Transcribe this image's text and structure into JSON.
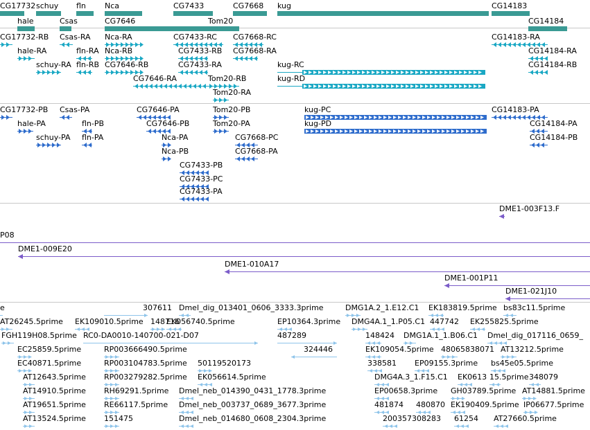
{
  "colors": {
    "gene": "#3a9a94",
    "transcript": "#1aa8c4",
    "protein": "#2e6ccc",
    "clone": "#7b5cc9",
    "est": "#8ec4ea",
    "separator": "#c8c8c8"
  },
  "tracks": {
    "genes": {
      "features": [
        {
          "label": "CG17732"
        },
        {
          "label": "hale"
        },
        {
          "label": "schuy"
        },
        {
          "label": "Csas"
        },
        {
          "label": "fln"
        },
        {
          "label": "Nca"
        },
        {
          "label": "CG7646"
        },
        {
          "label": "CG7433"
        },
        {
          "label": "Tom20"
        },
        {
          "label": "CG7668"
        },
        {
          "label": "kug"
        },
        {
          "label": "CG14183"
        },
        {
          "label": "CG14184"
        }
      ]
    },
    "transcripts": {
      "features": [
        {
          "label": "CG17732-RB"
        },
        {
          "label": "Csas-RA"
        },
        {
          "label": "Nca-RA"
        },
        {
          "label": "CG7433-RC"
        },
        {
          "label": "CG7668-RC"
        },
        {
          "label": "CG14183-RA"
        },
        {
          "label": "hale-RA"
        },
        {
          "label": "fln-RA"
        },
        {
          "label": "Nca-RB"
        },
        {
          "label": "CG7433-RB"
        },
        {
          "label": "CG7668-RA"
        },
        {
          "label": "CG14184-RA"
        },
        {
          "label": "schuy-RA"
        },
        {
          "label": "fln-RB"
        },
        {
          "label": "CG7646-RB"
        },
        {
          "label": "CG7433-RA"
        },
        {
          "label": "kug-RC"
        },
        {
          "label": "CG14184-RB"
        },
        {
          "label": "CG7646-RA"
        },
        {
          "label": "Tom20-RB"
        },
        {
          "label": "kug-RD"
        },
        {
          "label": "Tom20-RA"
        }
      ]
    },
    "proteins": {
      "features": [
        {
          "label": "CG17732-PB"
        },
        {
          "label": "Csas-PA"
        },
        {
          "label": "CG7646-PA"
        },
        {
          "label": "Tom20-PB"
        },
        {
          "label": "kug-PC"
        },
        {
          "label": "CG14183-PA"
        },
        {
          "label": "hale-PA"
        },
        {
          "label": "fln-PB"
        },
        {
          "label": "CG7646-PB"
        },
        {
          "label": "Tom20-PA"
        },
        {
          "label": "kug-PD"
        },
        {
          "label": "CG14184-PA"
        },
        {
          "label": "schuy-PA"
        },
        {
          "label": "fln-PA"
        },
        {
          "label": "CG7668-PC"
        },
        {
          "label": "CG14184-PB"
        },
        {
          "label": "Nca-PA"
        },
        {
          "label": "CG7668-PA"
        },
        {
          "label": "Nca-PB"
        },
        {
          "label": "CG7433-PB"
        },
        {
          "label": "CG7433-PC"
        },
        {
          "label": "CG7433-PA"
        }
      ]
    },
    "clones": {
      "features": [
        {
          "label": "DME1-003F13.F"
        },
        {
          "label": "P08"
        },
        {
          "label": "DME1-009E20"
        },
        {
          "label": "DME1-010A17"
        },
        {
          "label": "DME1-001P11"
        },
        {
          "label": "DME1-021J10"
        }
      ]
    },
    "ests": {
      "features": [
        {
          "label": "e"
        },
        {
          "label": "307611"
        },
        {
          "label": "Dmel_dig_013401_0606_3333.3prime"
        },
        {
          "label": "DMG1A.2_1.E12.C1"
        },
        {
          "label": "EK183819.5prime"
        },
        {
          "label": "bs83c11.5prime"
        },
        {
          "label": "AT26245.5prime"
        },
        {
          "label": "EK109010.5prime"
        },
        {
          "label": "148716"
        },
        {
          "label": "EK056740.5prime"
        },
        {
          "label": "EP10364.3prime"
        },
        {
          "label": "DMG4A.1_1.P05.C1"
        },
        {
          "label": "447742"
        },
        {
          "label": "EK255825.5prime"
        },
        {
          "label": "FGH119H08.5prime"
        },
        {
          "label": "RC0-DA0010-140700-021-D07"
        },
        {
          "label": "487289"
        },
        {
          "label": "148424"
        },
        {
          "label": "DMG1A.1_1.B06.C1"
        },
        {
          "label": "Dmel_dig_017116_0659_"
        },
        {
          "label": "EC25859.5prime"
        },
        {
          "label": "RP003666490.5prime"
        },
        {
          "label": "324446"
        },
        {
          "label": "EK109054.5prime"
        },
        {
          "label": "48065838071"
        },
        {
          "label": "AT13212.5prime"
        },
        {
          "label": "EC40871.5prime"
        },
        {
          "label": "RP003104783.5prime"
        },
        {
          "label": "50119520173"
        },
        {
          "label": "338581"
        },
        {
          "label": "EP09155.3prime"
        },
        {
          "label": "bs45e05.5prime"
        },
        {
          "label": "AT12643.5prime"
        },
        {
          "label": "RP003279282.5prime"
        },
        {
          "label": "EK056614.5prime"
        },
        {
          "label": "DMG4A.3_1.F15.C1"
        },
        {
          "label": "EK0613"
        },
        {
          "label": "15.5prime"
        },
        {
          "label": "348079"
        },
        {
          "label": "AT14910.5prime"
        },
        {
          "label": "RH69291.5prime"
        },
        {
          "label": "Dmel_neb_014390_0431_1778.3prime"
        },
        {
          "label": "EP00658.3prime"
        },
        {
          "label": "GH03789.5prime"
        },
        {
          "label": "AT14881.5prime"
        },
        {
          "label": "AT19651.5prime"
        },
        {
          "label": "RE66117.5prime"
        },
        {
          "label": "Dmel_neb_003737_0689_3677.3prime"
        },
        {
          "label": "481874"
        },
        {
          "label": "480870"
        },
        {
          "label": "EK190409.5prime"
        },
        {
          "label": "IP06677.5prime"
        },
        {
          "label": "AT13524.5prime"
        },
        {
          "label": "151475"
        },
        {
          "label": "Dmel_neb_014680_0608_2304.3prime"
        },
        {
          "label": "200357308283"
        },
        {
          "label": "61254"
        },
        {
          "label": "AT27660.5prime"
        }
      ]
    }
  }
}
